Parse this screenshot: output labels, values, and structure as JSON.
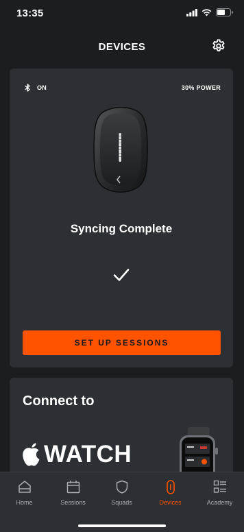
{
  "status_bar": {
    "time": "13:35"
  },
  "header": {
    "title": "DEVICES"
  },
  "device_card": {
    "bluetooth_status": "ON",
    "power_status": "30% POWER",
    "sync_message": "Syncing Complete",
    "setup_button_label": "SET UP SESSIONS"
  },
  "connect_card": {
    "title": "Connect to",
    "watch_label": "WATCH"
  },
  "tab_bar": {
    "active_tab": "Devices",
    "accent_color": "#ff5300",
    "tabs": [
      {
        "label": "Home",
        "icon": "home-icon"
      },
      {
        "label": "Sessions",
        "icon": "calendar-icon"
      },
      {
        "label": "Squads",
        "icon": "shield-icon"
      },
      {
        "label": "Devices",
        "icon": "device-icon"
      },
      {
        "label": "Academy",
        "icon": "list-icon"
      }
    ]
  }
}
